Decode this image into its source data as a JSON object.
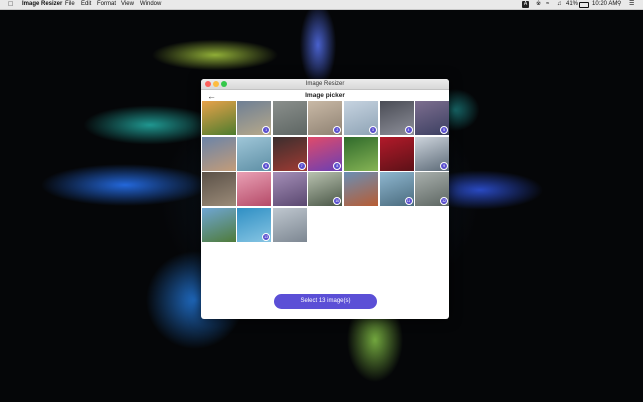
{
  "menubar": {
    "app_name": "Image Resizer",
    "menus": [
      "File",
      "Edit",
      "Format",
      "View",
      "Window"
    ],
    "status": {
      "input_source": "A",
      "battery": "41%",
      "time": "10:20 AM"
    }
  },
  "window": {
    "title": "Image Resizer",
    "header_title": "Image picker",
    "back_icon": "←",
    "tiles": [
      {
        "colors": [
          "#e8a24a",
          "#4d7c2e"
        ],
        "badge": ""
      },
      {
        "colors": [
          "#6e7f95",
          "#b7a98a"
        ],
        "badge": "1"
      },
      {
        "colors": [
          "#8a8f8c",
          "#5e6663"
        ],
        "badge": ""
      },
      {
        "colors": [
          "#c9b9a6",
          "#8f8273"
        ],
        "badge": "2"
      },
      {
        "colors": [
          "#c6d3e0",
          "#8ea3b5"
        ],
        "badge": "3"
      },
      {
        "colors": [
          "#4a4c55",
          "#8d8f99"
        ],
        "badge": "4"
      },
      {
        "colors": [
          "#7d6e8f",
          "#3b3f61"
        ],
        "badge": "5"
      },
      {
        "colors": [
          "#6b84a8",
          "#c39c79"
        ],
        "badge": ""
      },
      {
        "colors": [
          "#9fc6d8",
          "#5e8fa5"
        ],
        "badge": "6"
      },
      {
        "colors": [
          "#3b2e2e",
          "#a03b33"
        ],
        "badge": "7"
      },
      {
        "colors": [
          "#e04b6a",
          "#6a3fb4"
        ],
        "badge": "8"
      },
      {
        "colors": [
          "#2f6a2b",
          "#86b455"
        ],
        "badge": ""
      },
      {
        "colors": [
          "#b21a2a",
          "#5c1117"
        ],
        "badge": ""
      },
      {
        "colors": [
          "#cdd4dc",
          "#5d6b78"
        ],
        "badge": "9"
      },
      {
        "colors": [
          "#5b5148",
          "#9b8b78"
        ],
        "badge": ""
      },
      {
        "colors": [
          "#e9a1b5",
          "#b54a68"
        ],
        "badge": ""
      },
      {
        "colors": [
          "#a58fb8",
          "#5a4870"
        ],
        "badge": ""
      },
      {
        "colors": [
          "#b9c2b0",
          "#4a5747"
        ],
        "badge": "10"
      },
      {
        "colors": [
          "#6a8fb5",
          "#b85c33"
        ],
        "badge": ""
      },
      {
        "colors": [
          "#8fb7d0",
          "#4a6b7d"
        ],
        "badge": "11"
      },
      {
        "colors": [
          "#a9b0ad",
          "#5d6662"
        ],
        "badge": "12"
      },
      {
        "colors": [
          "#6fa6d4",
          "#4f7b3a"
        ],
        "badge": ""
      },
      {
        "colors": [
          "#2f8fc4",
          "#87c5e3"
        ],
        "badge": "13"
      },
      {
        "colors": [
          "#bfc7cf",
          "#7d8792"
        ],
        "badge": ""
      }
    ],
    "select_button": "Select 13 image(s)"
  },
  "colors": {
    "accent": "#5b4fd6",
    "badge": "#5a4fcf",
    "close": "#fc605b",
    "minimize": "#fdbc40",
    "zoom": "#34c84a"
  }
}
